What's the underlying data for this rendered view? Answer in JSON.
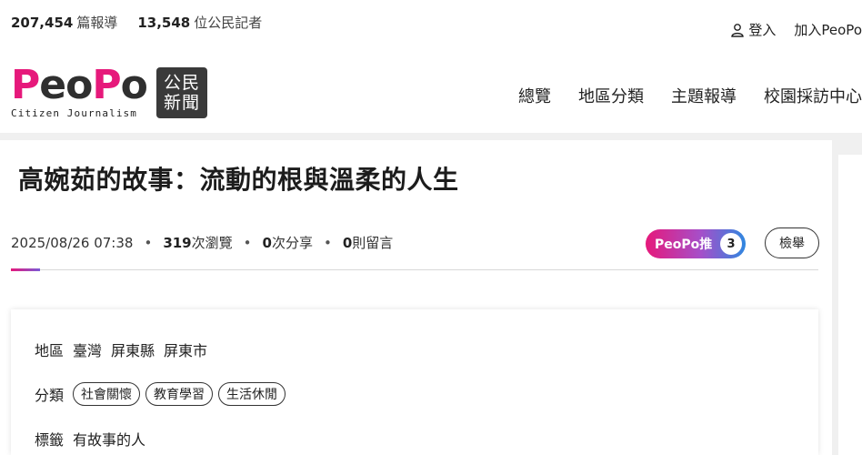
{
  "header": {
    "stats": [
      {
        "count": "207,454",
        "unit": "篇報導"
      },
      {
        "count": "13,548",
        "unit": "位公民記者"
      }
    ],
    "login_label": "登入",
    "join_label": "加入PeoPo",
    "logo": {
      "word": "PeoPo",
      "sub": "Citizen Journalism",
      "badge_line1": "公民",
      "badge_line2": "新聞"
    },
    "nav": [
      "總覽",
      "地區分類",
      "主題報導",
      "校園採訪中心"
    ]
  },
  "article": {
    "title": "高婉茹的故事：流動的根與溫柔的人生",
    "date": "2025/08/26 07:38",
    "views_count": "319",
    "views_label": "次瀏覽",
    "shares_count": "0",
    "shares_label": "次分享",
    "comments_count": "0",
    "comments_label": "則留言",
    "push_label": "PeoPo推",
    "push_count": "3",
    "report_label": "檢舉"
  },
  "info": {
    "region_label": "地區",
    "region_values": [
      "臺灣",
      "屏東縣",
      "屏東市"
    ],
    "category_label": "分類",
    "categories": [
      "社會關懷",
      "教育學習",
      "生活休閒"
    ],
    "tags_label": "標籤",
    "tags": [
      "有故事的人"
    ]
  },
  "colors": {
    "brand_pink": "#e6197b",
    "brand_blue": "#2f87e0",
    "badge_bg": "#3a3a3a"
  }
}
